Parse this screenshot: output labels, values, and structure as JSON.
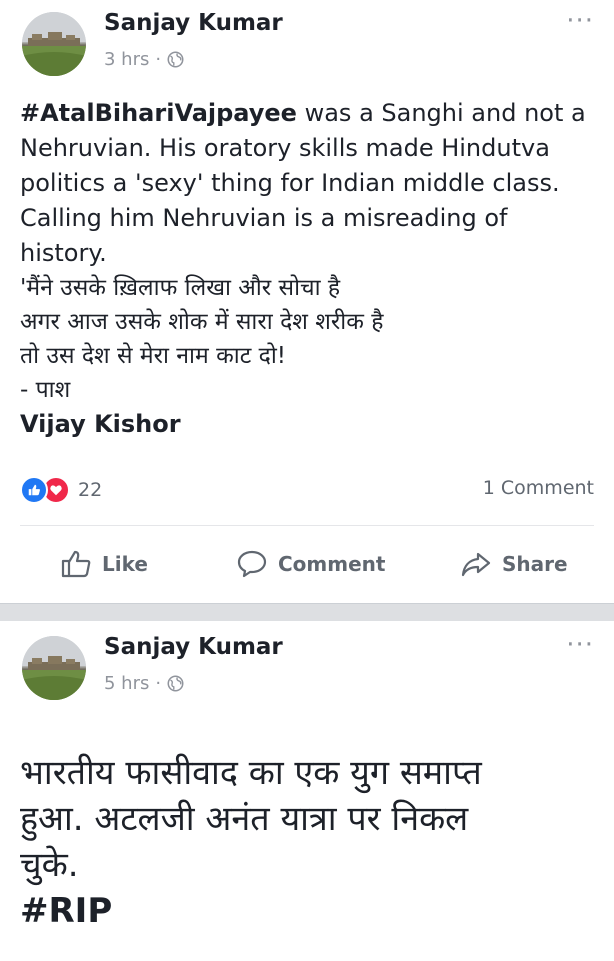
{
  "posts": [
    {
      "author": "Sanjay Kumar",
      "time": "3 hrs",
      "separator": "·",
      "more": "···",
      "hashtag": "#AtalBihariVajpayee",
      "text_en": " was a Sanghi and not a Nehruvian. His oratory skills made Hindutva politics a 'sexy' thing for Indian middle class. Calling him Nehruvian is a misreading of history.",
      "poem": [
        "'मैंने उसके ख़िलाफ लिखा और सोचा है",
        "अगर आज उसके शोक में सारा देश शरीक है",
        "तो उस देश से मेरा नाम काट दो!",
        "- पाश"
      ],
      "attribution": "Vijay Kishor",
      "reaction_count": "22",
      "comment_count": "1 Comment",
      "actions": {
        "like": "Like",
        "comment": "Comment",
        "share": "Share"
      },
      "colors": {
        "like_reaction": "#2078f4",
        "love_reaction": "#f0284a"
      }
    },
    {
      "author": "Sanjay Kumar",
      "time": "5 hrs",
      "separator": "·",
      "more": "···",
      "text_lines": [
        "भारतीय फासीवाद का एक युग समाप्त",
        "हुआ. अटलजी अनंत यात्रा पर निकल",
        "चुके."
      ],
      "hashtag": "#RIP"
    }
  ],
  "icons": [
    "globe-icon",
    "like-reaction-icon",
    "love-reaction-icon",
    "like-icon",
    "comment-icon",
    "share-icon",
    "more-options-icon"
  ]
}
